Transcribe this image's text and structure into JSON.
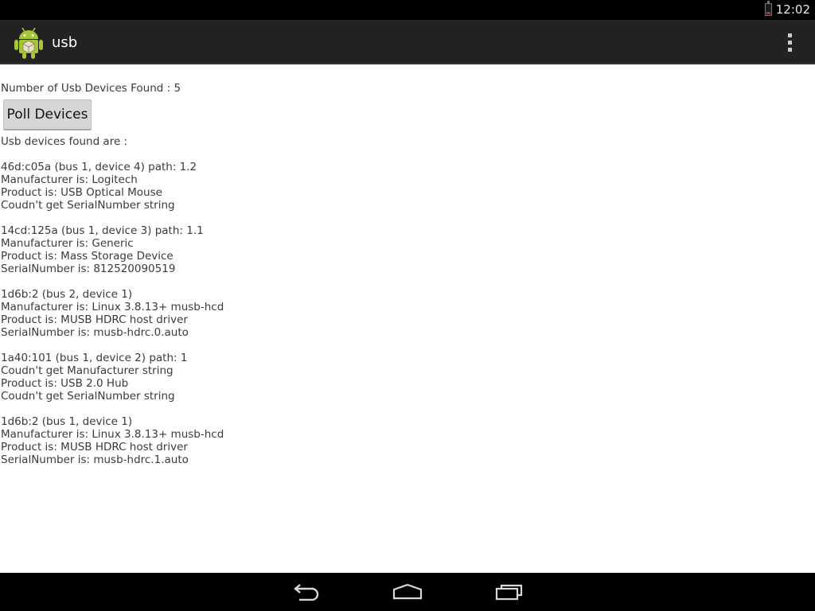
{
  "status_bar": {
    "time": "12:02",
    "battery_icon": "battery-low-icon",
    "battery_color": "#c62828"
  },
  "action_bar": {
    "app_icon": "android-robot-icon",
    "title": "usb",
    "overflow_icon": "overflow-menu-icon"
  },
  "main": {
    "count_label": "Number of Usb Devices Found : ",
    "count_value": "5",
    "poll_button_label": "Poll Devices",
    "found_label": "Usb devices found are :",
    "devices": [
      {
        "lines": [
          "46d:c05a (bus 1, device 4) path: 1.2",
          "Manufacturer is: Logitech",
          "Product is: USB Optical Mouse",
          "Coudn't get SerialNumber string"
        ]
      },
      {
        "lines": [
          "14cd:125a (bus 1, device 3) path: 1.1",
          "Manufacturer is: Generic",
          "Product is: Mass Storage Device",
          "SerialNumber is: 812520090519"
        ]
      },
      {
        "lines": [
          "1d6b:2 (bus 2, device 1)",
          "Manufacturer is: Linux 3.8.13+ musb-hcd",
          "Product is: MUSB HDRC host driver",
          "SerialNumber is: musb-hdrc.0.auto"
        ]
      },
      {
        "lines": [
          "1a40:101 (bus 1, device 2) path: 1",
          "Coudn't get Manufacturer string",
          "Product is: USB 2.0 Hub",
          "Coudn't get SerialNumber string"
        ]
      },
      {
        "lines": [
          "1d6b:2 (bus 1, device 1)",
          "Manufacturer is: Linux 3.8.13+ musb-hcd",
          "Product is: MUSB HDRC host driver",
          "SerialNumber is: musb-hdrc.1.auto"
        ]
      }
    ]
  },
  "nav_bar": {
    "back_icon": "back-icon",
    "home_icon": "home-icon",
    "recents_icon": "recents-icon"
  },
  "colors": {
    "action_bar_bg": "#222222",
    "android_green": "#a4c639"
  }
}
